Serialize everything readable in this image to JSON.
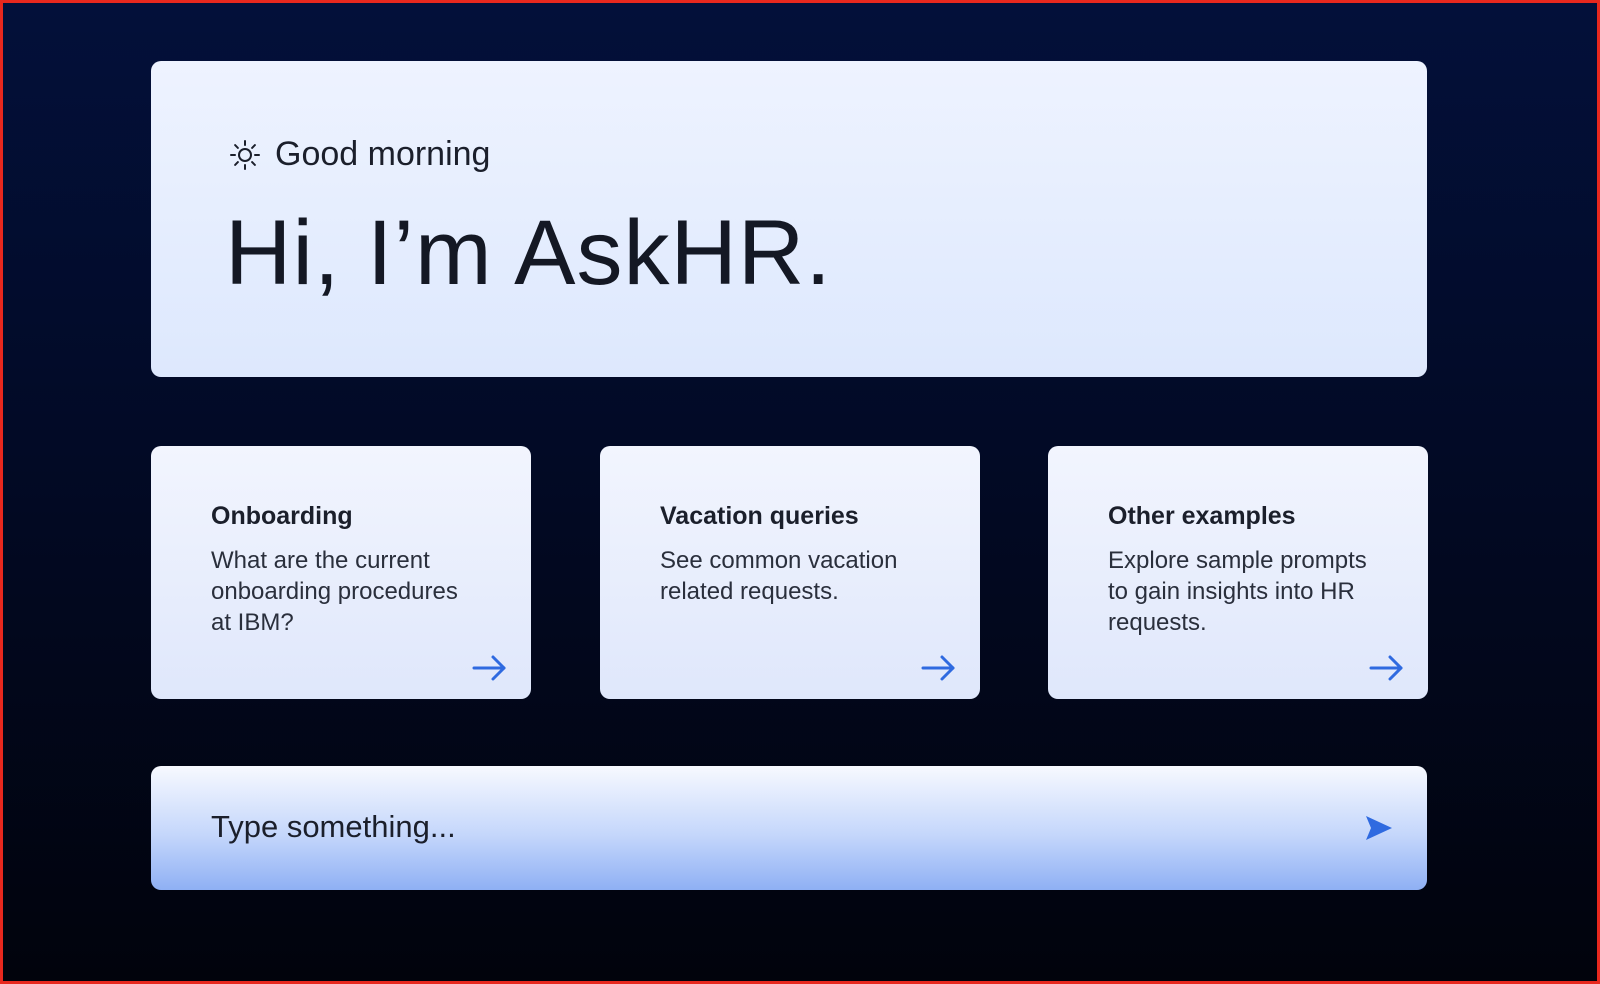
{
  "greeting": {
    "icon": "sun-icon",
    "text": "Good morning"
  },
  "hero": {
    "title": "Hi, I’m AskHR."
  },
  "cards": [
    {
      "title": "Onboarding",
      "description": "What are the current onboarding procedures at IBM?",
      "icon": "arrow-right-icon"
    },
    {
      "title": "Vacation queries",
      "description": "See common vacation related requests.",
      "icon": "arrow-right-icon"
    },
    {
      "title": "Other examples",
      "description": "Explore sample prompts to gain insights into HR requests.",
      "icon": "arrow-right-icon"
    }
  ],
  "chat": {
    "placeholder": "Type something...",
    "send_icon": "send-icon"
  },
  "colors": {
    "accent": "#2f6ae0",
    "background_top": "#03103a",
    "background_bottom": "#01030c",
    "frame_border": "#e8281e",
    "card_bg": "#eef3ff",
    "text": "#1b1f2b"
  }
}
